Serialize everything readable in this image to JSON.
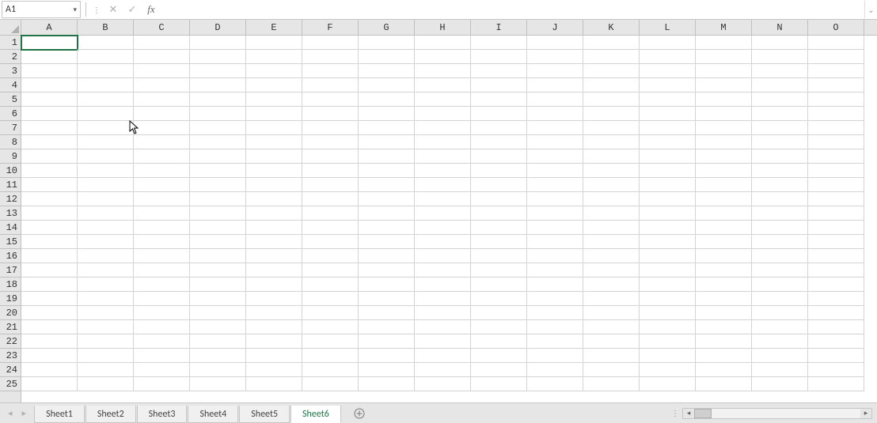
{
  "formula_bar": {
    "name_box": "A1",
    "formula_value": ""
  },
  "grid": {
    "columns": [
      "A",
      "B",
      "C",
      "D",
      "E",
      "F",
      "G",
      "H",
      "I",
      "J",
      "K",
      "L",
      "M",
      "N",
      "O"
    ],
    "rows": [
      1,
      2,
      3,
      4,
      5,
      6,
      7,
      8,
      9,
      10,
      11,
      12,
      13,
      14,
      15,
      16,
      17,
      18,
      19,
      20,
      21,
      22,
      23,
      24,
      25
    ],
    "active_cell": "A1"
  },
  "sheets": {
    "tabs": [
      "Sheet1",
      "Sheet2",
      "Sheet3",
      "Sheet4",
      "Sheet5",
      "Sheet6"
    ],
    "active": "Sheet6"
  }
}
